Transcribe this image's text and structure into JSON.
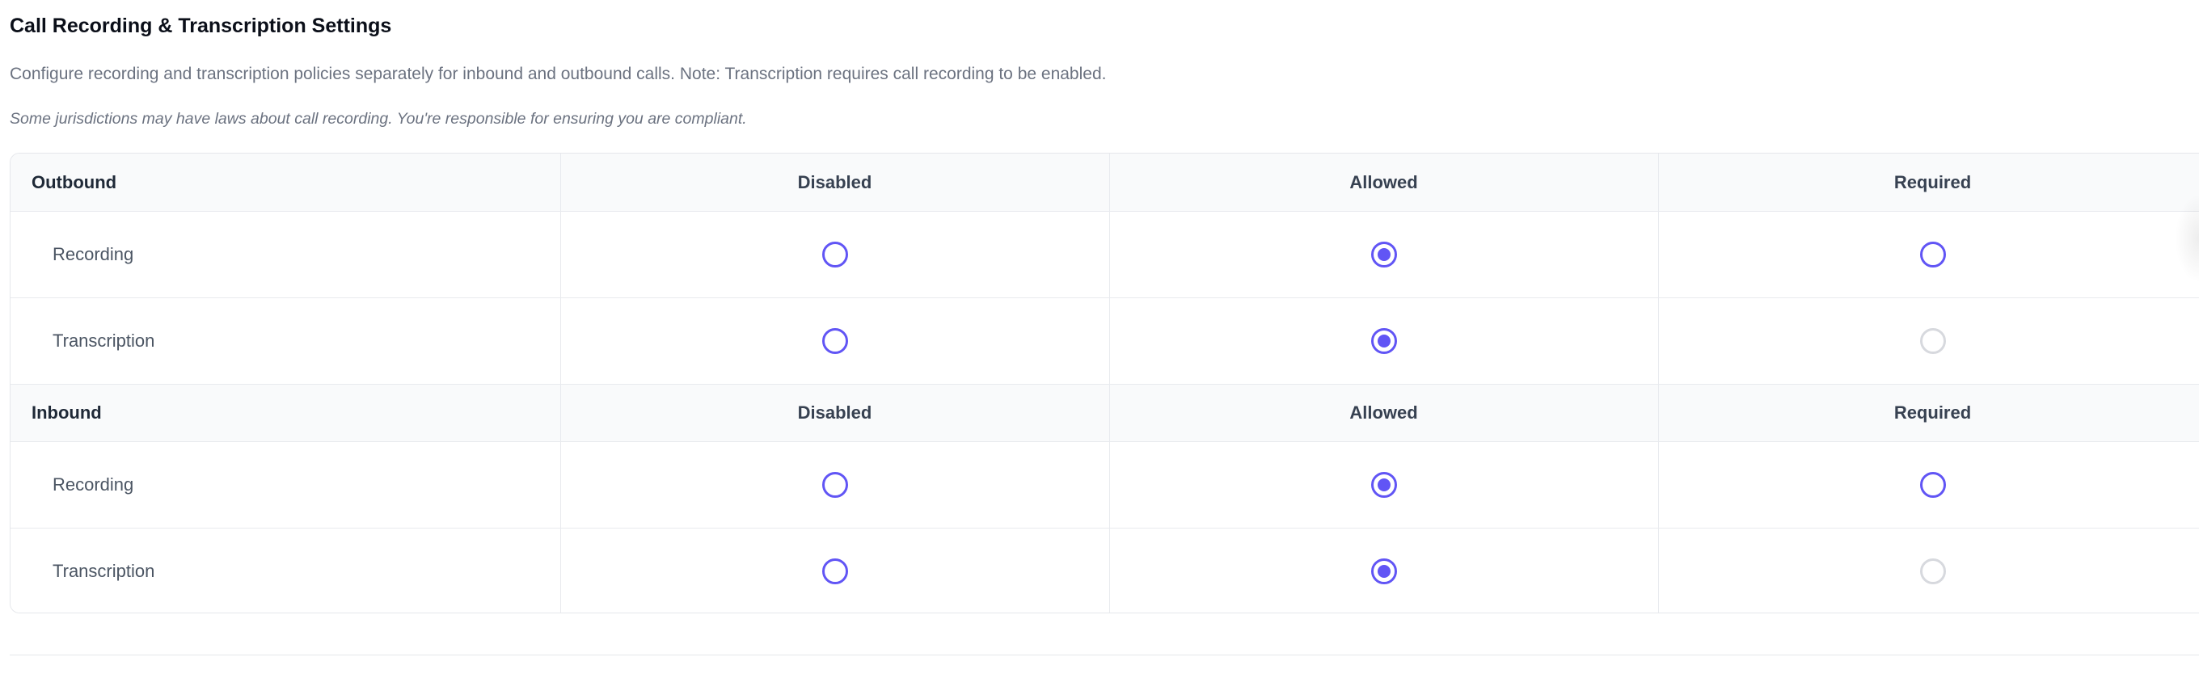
{
  "header": {
    "title": "Call Recording & Transcription Settings",
    "description": "Configure recording and transcription policies separately for inbound and outbound calls. Note: Transcription requires call recording to be enabled.",
    "note": "Some jurisdictions may have laws about call recording. You're responsible for ensuring you are compliant."
  },
  "columns": [
    "Disabled",
    "Allowed",
    "Required"
  ],
  "colors": {
    "accent": "#6155f5",
    "disabled_radio": "#d7d9de"
  },
  "groups": [
    {
      "label": "Outbound",
      "rows": [
        {
          "label": "Recording",
          "selected": "Allowed",
          "disabled_options": []
        },
        {
          "label": "Transcription",
          "selected": "Allowed",
          "disabled_options": [
            "Required"
          ]
        }
      ]
    },
    {
      "label": "Inbound",
      "rows": [
        {
          "label": "Recording",
          "selected": "Allowed",
          "disabled_options": []
        },
        {
          "label": "Transcription",
          "selected": "Allowed",
          "disabled_options": [
            "Required"
          ]
        }
      ]
    }
  ]
}
